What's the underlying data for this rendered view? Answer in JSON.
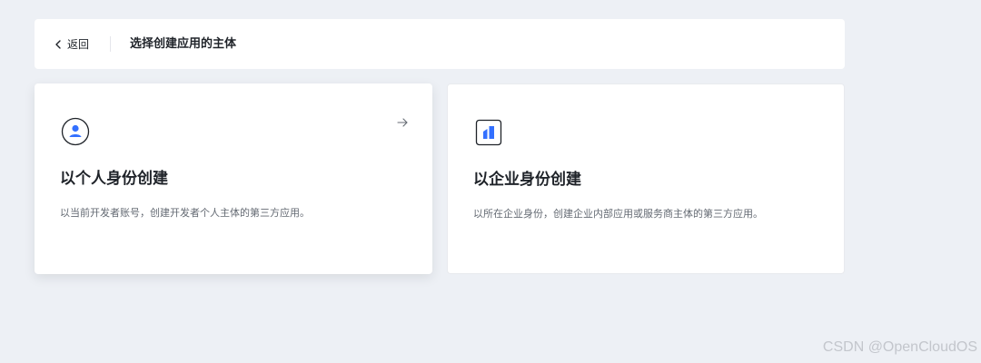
{
  "header": {
    "back_label": "返回",
    "title": "选择创建应用的主体"
  },
  "cards": [
    {
      "title": "以个人身份创建",
      "description": "以当前开发者账号，创建开发者个人主体的第三方应用。",
      "icon": "user-circle-icon",
      "hovered": true
    },
    {
      "title": "以企业身份创建",
      "description": "以所在企业身份，创建企业内部应用或服务商主体的第三方应用。",
      "icon": "building-icon",
      "hovered": false
    }
  ],
  "watermark": "CSDN @OpenCloudOS",
  "colors": {
    "accent": "#3370ff",
    "background": "#edf0f5",
    "text_primary": "#1f2329",
    "text_secondary": "#646a73"
  }
}
